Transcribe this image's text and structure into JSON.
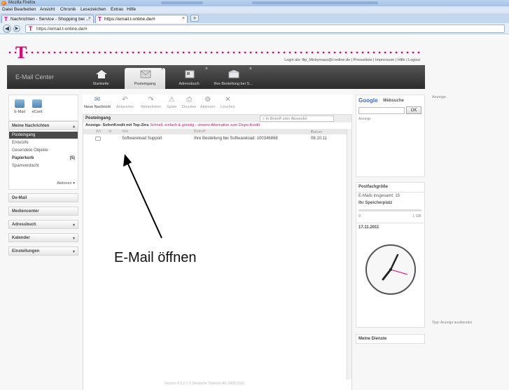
{
  "browser": {
    "window_title": "Mozilla Firefox",
    "menu": [
      "Datei",
      "Bearbeiten",
      "Ansicht",
      "Chronik",
      "Lesezeichen",
      "Extras",
      "Hilfe"
    ],
    "tabs": [
      {
        "label": "Nachrichten - Service - Shopping bei ...",
        "active": false
      },
      {
        "label": "https://email.t-online.de/#",
        "active": true
      }
    ],
    "newtab_label": "+",
    "url": "https://email.t-online.de/#"
  },
  "header": {
    "login_text": "Login als: flip_Mickymaus@t-online.de | Presseliste | Impressum | Hilfe | Logout",
    "app_title": "E-Mail Center",
    "tabs": [
      {
        "label": "Startseite",
        "active": false,
        "closable": false
      },
      {
        "label": "Posteingang",
        "active": true,
        "closable": true
      },
      {
        "label": "Adressbuch",
        "active": false,
        "closable": true
      },
      {
        "label": "Ihre Bestellung bei S...",
        "active": false,
        "closable": true
      }
    ]
  },
  "sidebar": {
    "apps": [
      {
        "label": "E-Mail"
      },
      {
        "label": "eCard"
      }
    ],
    "section_title": "Meine Nachrichten",
    "folders": [
      {
        "label": "Posteingang",
        "count": "",
        "selected": true,
        "bold": false
      },
      {
        "label": "Entwürfe",
        "count": "",
        "selected": false,
        "bold": false
      },
      {
        "label": "Gesendete Objekte",
        "count": "",
        "selected": false,
        "bold": false
      },
      {
        "label": "Papierkorb",
        "count": "(5)",
        "selected": false,
        "bold": true
      },
      {
        "label": "Spamverdacht",
        "count": "",
        "selected": false,
        "bold": false
      }
    ],
    "actions_label": "Aktionen ▾",
    "sections": [
      {
        "label": "De-Mail",
        "has_arrow": false
      },
      {
        "label": "Mediencenter",
        "has_arrow": false
      },
      {
        "label": "Adressbuch",
        "has_arrow": true
      },
      {
        "label": "Kalender",
        "has_arrow": true
      },
      {
        "label": "Einstellungen",
        "has_arrow": true
      }
    ]
  },
  "toolbar": {
    "buttons": [
      {
        "label": "Neue Nachricht",
        "icon": "new-mail-icon",
        "glyph": "✉"
      },
      {
        "label": "Antworten",
        "icon": "reply-icon",
        "glyph": "↶"
      },
      {
        "label": "Weiterleiten",
        "icon": "forward-icon",
        "glyph": "↷"
      },
      {
        "label": "Spam",
        "icon": "spam-icon",
        "glyph": "⚠"
      },
      {
        "label": "Drucken",
        "icon": "print-icon",
        "glyph": "⎙"
      },
      {
        "label": "Aktionen",
        "icon": "gear-icon",
        "glyph": "⚙"
      },
      {
        "label": "Löschen",
        "icon": "delete-icon",
        "glyph": "✕"
      }
    ]
  },
  "mailpane": {
    "title": "Posteingang",
    "search_placeholder": "In Betreff oder Absender",
    "ad_bold": "Anzeige: SofortKredit mit Top-Zins",
    "ad_link": "Schnell, einfach & günstig - clevere Alternative zum Dispo-Kredit",
    "columns": {
      "art": "Art",
      "von": "Von",
      "betreff": "Betreff",
      "datum": "Datum"
    },
    "mails": [
      {
        "from": "Softwareload Support",
        "subject": "Ihre Bestellung bei Softwareload: 100346868",
        "date": "08.10.11"
      }
    ],
    "footer": "Version 4.5.2.1 © Deutsche Telekom AG 2009-2011"
  },
  "right": {
    "google_logo": "Google",
    "google_label": "Websuche",
    "google_ok": "OK",
    "google_ad": "Anzeige",
    "side_ad": "Anzeige",
    "postfach_title": "Postfachgröße",
    "postfach_mails": "E-Mails insgesamt: 15",
    "postfach_storage": "Ihr Speicherplatz",
    "postfach_usage": 0.0,
    "postfach_min": "0",
    "postfach_max": "1 GB",
    "date": "17.11.2011",
    "meine_dienste": "Meine Dienste",
    "tipp": "Tipp: Anzeige ausblenden"
  },
  "annotation": {
    "text": "E-Mail öffnen"
  },
  "colors": {
    "brand": "#e2007a",
    "selected_folder": "#4a4a4a",
    "google_blue": "#3367d6"
  }
}
